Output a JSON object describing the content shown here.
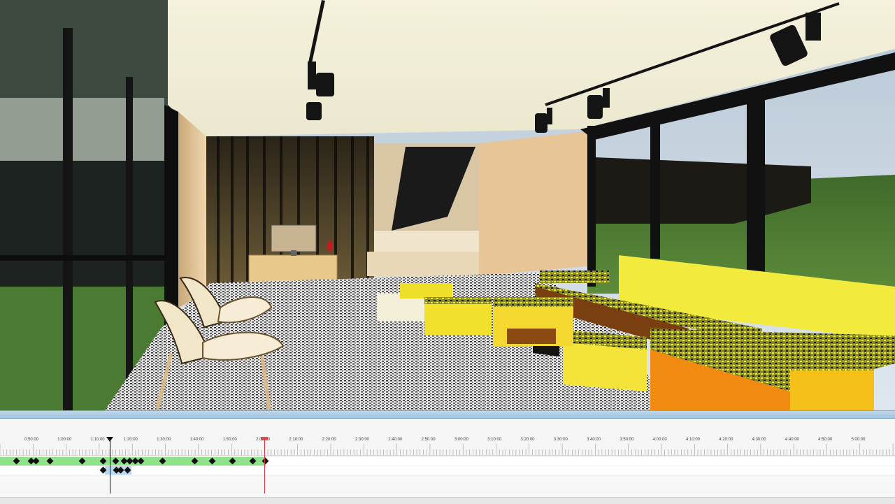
{
  "viewport": {
    "scene": "3d-living-room-render"
  },
  "timeline": {
    "tick_labels": [
      "0:50:00",
      "1:00:00",
      "1:10:00",
      "1:20:00",
      "1:30:00",
      "1:40:00",
      "1:50:00",
      "2:00:00",
      "2:10:00",
      "2:20:00",
      "2:30:00",
      "2:40:00",
      "2:50:00",
      "3:00:00",
      "3:10:00",
      "3:20:00",
      "3:30:00",
      "3:40:00",
      "3:50:00",
      "4:00:00",
      "4:10:00",
      "4:20:00",
      "4:30:00",
      "4:40:00",
      "4:50:00",
      "5:00:00"
    ],
    "track1_keyframes": 17,
    "track2_keyframes": 4,
    "colors": {
      "track_range": "#8ee38a",
      "secondary_range": "#b8d8ee",
      "playhead": "#111111",
      "end_marker": "#e0303a",
      "separator": "#a9cbe6"
    }
  }
}
